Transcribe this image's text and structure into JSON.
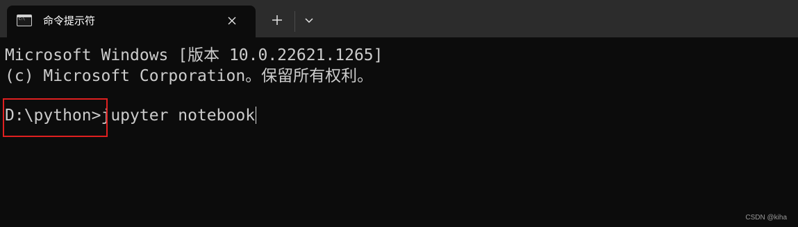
{
  "tab": {
    "icon": "command-prompt-icon",
    "title": "命令提示符",
    "close_icon": "close-icon"
  },
  "toolbar": {
    "new_tab_icon": "plus-icon",
    "dropdown_icon": "chevron-down-icon"
  },
  "console": {
    "lines": [
      "Microsoft Windows [版本 10.0.22621.1265]",
      "(c) Microsoft Corporation。保留所有权利。"
    ],
    "prompt": "D:\\python>",
    "command": "jupyter notebook"
  },
  "colors": {
    "titlebar": "#2c2c2c",
    "background": "#0c0c0c",
    "text": "#cccccc",
    "highlight": "#e02020"
  },
  "watermark": "CSDN @kiha"
}
